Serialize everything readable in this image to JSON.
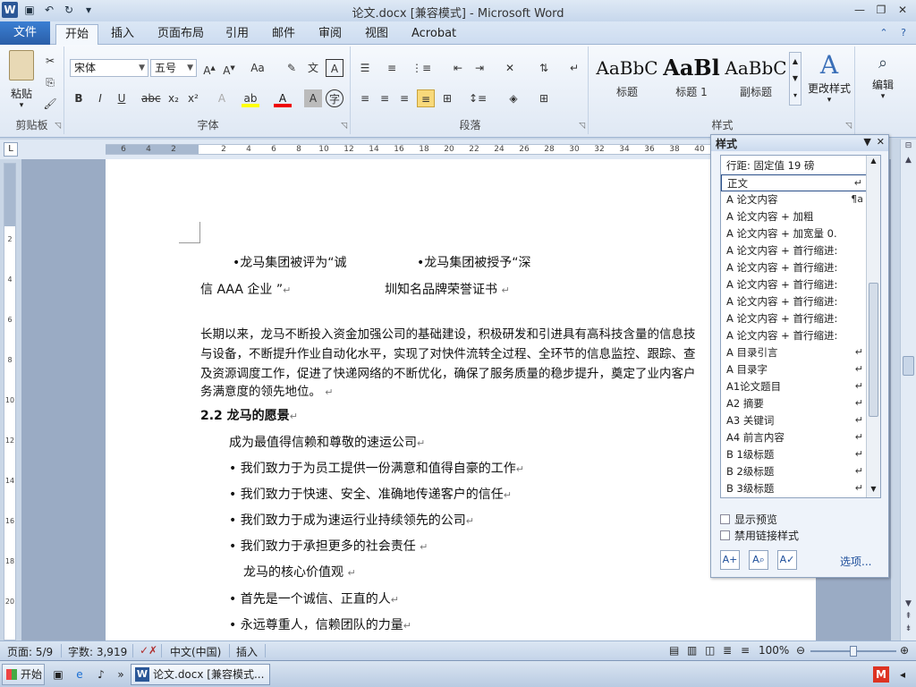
{
  "window": {
    "title": "论文.docx [兼容模式] - Microsoft Word"
  },
  "quick_access": {
    "app_icon": "W",
    "save_icon": "save-icon",
    "undo_icon": "undo-icon",
    "redo_icon": "redo-icon"
  },
  "tabs": [
    {
      "label": "文件"
    },
    {
      "label": "开始"
    },
    {
      "label": "插入"
    },
    {
      "label": "页面布局"
    },
    {
      "label": "引用"
    },
    {
      "label": "邮件"
    },
    {
      "label": "审阅"
    },
    {
      "label": "视图"
    },
    {
      "label": "Acrobat"
    }
  ],
  "ribbon": {
    "clipboard": {
      "paste_label": "粘贴",
      "group_label": "剪贴板"
    },
    "font": {
      "font_name": "宋体",
      "font_size": "五号",
      "group_label": "字体"
    },
    "paragraph": {
      "group_label": "段落"
    },
    "styles": {
      "items": [
        {
          "preview": "AaBbC",
          "caption": "标题"
        },
        {
          "preview": "AaBl",
          "caption": "标题 1"
        },
        {
          "preview": "AaBbC",
          "caption": "副标题"
        }
      ],
      "change_styles": "更改样式",
      "group_label": "样式"
    },
    "editing": {
      "label": "编辑"
    }
  },
  "ruler": {
    "numbers": [
      "6",
      "4",
      "2",
      "2",
      "4",
      "6",
      "8",
      "10",
      "12",
      "14",
      "16",
      "18",
      "20",
      "22",
      "24",
      "26",
      "28",
      "30",
      "32",
      "34",
      "36",
      "38",
      "40"
    ],
    "vnumbers": [
      "2",
      "4",
      "6",
      "8",
      "10",
      "12",
      "14",
      "16",
      "18",
      "20"
    ]
  },
  "document": {
    "lines": [
      {
        "text": "•龙马集团被评为“诚",
        "mark": ""
      },
      {
        "text": "•龙马集团被授予“深",
        "mark": ""
      },
      {
        "text": "信 AAA 企业 ”",
        "mark": "↵"
      },
      {
        "text": "圳知名品牌荣誉证书",
        "mark": "↵"
      },
      {
        "text": "长期以来，龙马不断投入资金加强公司的基础建设，积极研发和引进具有高科技含量的信息技",
        "mark": ""
      },
      {
        "text": "与设备，不断提升作业自动化水平，实现了对快件流转全过程、全环节的信息监控、跟踪、查",
        "mark": ""
      },
      {
        "text": "及资源调度工作，促进了快递网络的不断优化，确保了服务质量的稳步提升，奠定了业内客户",
        "mark": ""
      },
      {
        "text": "务满意度的领先地位。",
        "mark": "↵"
      },
      {
        "text": "2.2  龙马的愿景",
        "mark": "↵"
      },
      {
        "text": "成为最值得信赖和尊敬的速运公司",
        "mark": "↵"
      },
      {
        "text": "•  我们致力于为员工提供一份满意和值得自豪的工作",
        "mark": "↵"
      },
      {
        "text": "•  我们致力于快速、安全、准确地传递客户的信任",
        "mark": "↵"
      },
      {
        "text": "•  我们致力于成为速运行业持续领先的公司",
        "mark": "↵"
      },
      {
        "text": "•  我们致力于承担更多的社会责任",
        "mark": "↵"
      },
      {
        "text": "龙马的核心价值观",
        "mark": "↵"
      },
      {
        "text": "•  首先是一个诚信、正直的人",
        "mark": "↵"
      },
      {
        "text": "•  永远尊重人，信赖团队的力量",
        "mark": "↵"
      }
    ]
  },
  "styles_pane": {
    "title": "样式",
    "items": [
      {
        "label": "行距:  固定值 19 磅",
        "sym": ""
      },
      {
        "label": "正文",
        "sym": "↵"
      },
      {
        "label": "A 论文内容",
        "sym": "¶a"
      },
      {
        "label": "A 论文内容 + 加粗",
        "sym": ""
      },
      {
        "label": "A 论文内容 + 加宽量  0.",
        "sym": ""
      },
      {
        "label": "A 论文内容 + 首行缩进:",
        "sym": ""
      },
      {
        "label": "A 论文内容 + 首行缩进:",
        "sym": ""
      },
      {
        "label": "A 论文内容 + 首行缩进:",
        "sym": ""
      },
      {
        "label": "A 论文内容 + 首行缩进:",
        "sym": ""
      },
      {
        "label": "A 论文内容 + 首行缩进:",
        "sym": ""
      },
      {
        "label": "A 论文内容 + 首行缩进:",
        "sym": ""
      },
      {
        "label": "A 目录引言",
        "sym": "↵"
      },
      {
        "label": "A 目录字",
        "sym": "↵"
      },
      {
        "label": "A1论文题目",
        "sym": "↵"
      },
      {
        "label": "A2  摘要",
        "sym": "↵"
      },
      {
        "label": "A3  关键词",
        "sym": "↵"
      },
      {
        "label": "A4  前言内容",
        "sym": "↵"
      },
      {
        "label": "B  1级标题",
        "sym": "↵"
      },
      {
        "label": "B  2级标题",
        "sym": "↵"
      },
      {
        "label": "B  3级标题",
        "sym": "↵"
      }
    ],
    "show_preview": "显示预览",
    "disable_linked": "禁用链接样式",
    "options_link": "选项..."
  },
  "status": {
    "page": "页面: 5/9",
    "words": "字数: 3,919",
    "language": "中文(中国)",
    "insert": "插入",
    "zoom": "100%"
  },
  "taskbar": {
    "start": "开始",
    "task_label": "论文.docx [兼容模式..."
  }
}
